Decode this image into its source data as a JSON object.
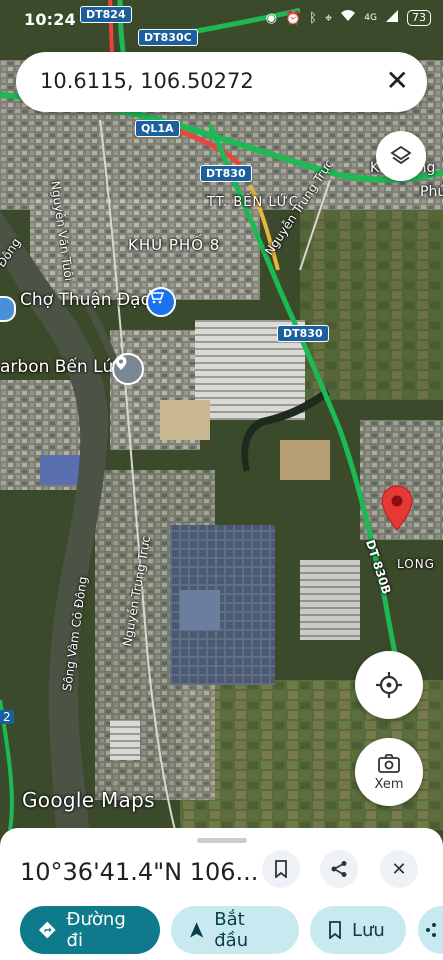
{
  "status_bar": {
    "time": "10:24",
    "network": "4G",
    "battery": "73"
  },
  "search": {
    "query": "10.6115, 106.50272"
  },
  "map_labels": {
    "road_dt824": "DT824",
    "road_dt830c": "DT830C",
    "road_ql1a": "QL1A",
    "road_dt830_a": "DT830",
    "road_dt830_b": "DT830",
    "road_dt830b": "DT 830B",
    "town": "TT. BẾN LỨC",
    "khu_pho": "KHU PHỐ 8",
    "street_nguyen_van_tuoi": "Nguyễn Văn Tuôi",
    "street_nguyen_trung_truc_1": "Nguyễn Trung Trực",
    "street_nguyen_trung_truc_2": "Nguyễn Trung Trực",
    "river": "Sông Vàm Cỏ Đông",
    "river_left": "Đông",
    "market": "Chợ Thuận Đạo",
    "carbon": "arbon Bến Lức",
    "long": "LONG",
    "khu_cong": "Khu công",
    "phu": "Phú",
    "edge_2": "2",
    "watermark": "Google Maps"
  },
  "buttons": {
    "view_label": "Xem"
  },
  "bottom_sheet": {
    "coordinates": "10°36'41.4\"N 106...",
    "actions": [
      {
        "label": "Đường đi"
      },
      {
        "label": "Bắt đầu"
      },
      {
        "label": "Lưu"
      }
    ]
  }
}
